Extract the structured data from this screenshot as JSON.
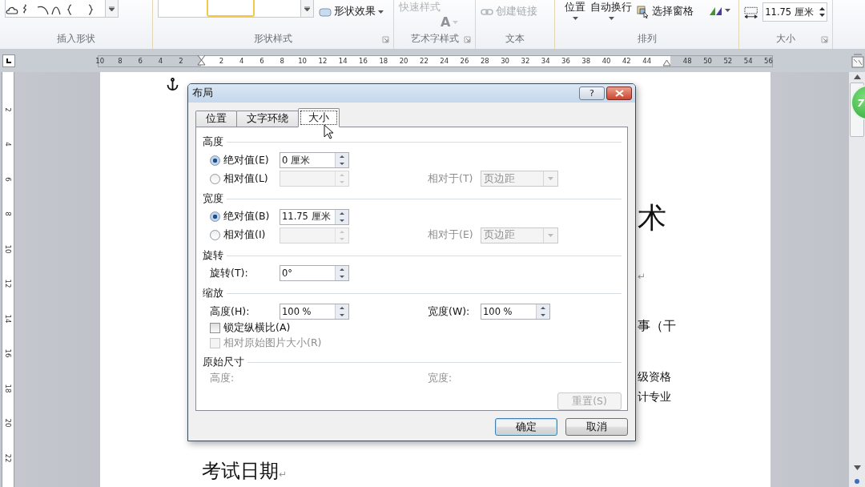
{
  "ribbon": {
    "groups": [
      {
        "kind": "shapes",
        "label": "插入形状"
      },
      {
        "kind": "styles",
        "label": "形状样式",
        "effects_button": "形状效果"
      },
      {
        "kind": "wordart",
        "label": "艺术字样式",
        "quick_styles": "快速样式",
        "text_effects": "A"
      },
      {
        "kind": "text",
        "label": "文本",
        "link_button": "创建链接"
      },
      {
        "kind": "arrange",
        "label": "排列",
        "position_button": "位置",
        "wrap_button": "自动换行",
        "pane_button": "选择窗格"
      },
      {
        "kind": "size",
        "label": "大小",
        "width_field": "11.75 厘米"
      }
    ]
  },
  "horizontal_ruler": {
    "ticks": [
      {
        "kind": "label",
        "text": "10"
      },
      {
        "kind": "label",
        "text": "8"
      },
      {
        "kind": "label",
        "text": "6"
      },
      {
        "kind": "label",
        "text": "4"
      },
      {
        "kind": "label",
        "text": "2"
      },
      {
        "kind": "indent"
      },
      {
        "kind": "label",
        "text": "2"
      },
      {
        "kind": "label",
        "text": "4"
      },
      {
        "kind": "label",
        "text": "6"
      },
      {
        "kind": "label",
        "text": "8"
      },
      {
        "kind": "label",
        "text": "10"
      },
      {
        "kind": "label",
        "text": "12"
      },
      {
        "kind": "label",
        "text": "14"
      },
      {
        "kind": "label",
        "text": "16"
      },
      {
        "kind": "label",
        "text": "18"
      },
      {
        "kind": "label",
        "text": "20"
      },
      {
        "kind": "label",
        "text": "22"
      },
      {
        "kind": "label",
        "text": "24"
      },
      {
        "kind": "label",
        "text": "26"
      },
      {
        "kind": "label",
        "text": "28"
      },
      {
        "kind": "label",
        "text": "30"
      },
      {
        "kind": "label",
        "text": "32"
      },
      {
        "kind": "label",
        "text": "34"
      },
      {
        "kind": "label",
        "text": "36"
      },
      {
        "kind": "label",
        "text": "38"
      },
      {
        "kind": "label",
        "text": "40"
      },
      {
        "kind": "label",
        "text": "42"
      },
      {
        "kind": "label",
        "text": "44"
      },
      {
        "kind": "right_indent"
      },
      {
        "kind": "label",
        "text": "48"
      },
      {
        "kind": "label",
        "text": "50"
      },
      {
        "kind": "label",
        "text": "52"
      },
      {
        "kind": "label",
        "text": "54"
      },
      {
        "kind": "label",
        "text": "56"
      }
    ]
  },
  "vertical_ruler": {
    "ticks": [
      "2",
      "4",
      "6",
      "8",
      "10",
      "12",
      "14",
      "16",
      "18",
      "20",
      "22"
    ]
  },
  "document": {
    "lines": [
      {
        "kind": "heading",
        "text": "术"
      },
      {
        "kind": "mark",
        "text": "↵"
      },
      {
        "kind": "body",
        "text": "事（干"
      },
      {
        "kind": "small",
        "text": "级资格"
      },
      {
        "kind": "small",
        "text": "计专业"
      }
    ],
    "footer": {
      "text": "考试日期",
      "para_mark": "↵"
    }
  },
  "scrollbar": {
    "badge": "7"
  },
  "dialog": {
    "title": "布局",
    "help_button": "?",
    "tabs": [
      {
        "label": "位置",
        "selected": false
      },
      {
        "label": "文字环绕",
        "selected": false
      },
      {
        "label": "大小",
        "selected": true
      }
    ],
    "sections": [
      {
        "kind": "size",
        "heading": "高度",
        "absolute": {
          "label": "绝对值(E)",
          "selected": true,
          "value": "0 厘米"
        },
        "relative": {
          "label": "相对值(L)",
          "selected": false,
          "relative_to_label": "相对于(T)",
          "relative_to_value": "页边距"
        }
      },
      {
        "kind": "size",
        "heading": "宽度",
        "absolute": {
          "label": "绝对值(B)",
          "selected": true,
          "value": "11.75 厘米"
        },
        "relative": {
          "label": "相对值(I)",
          "selected": false,
          "relative_to_label": "相对于(E)",
          "relative_to_value": "页边距"
        }
      },
      {
        "kind": "rotation",
        "heading": "旋转",
        "label": "旋转(T):",
        "value": "0°"
      },
      {
        "kind": "scale",
        "heading": "缩放",
        "height_label": "高度(H):",
        "height_value": "100 %",
        "width_label": "宽度(W):",
        "width_value": "100 %",
        "lock": {
          "label": "锁定纵横比(A)",
          "checked": false,
          "disabled": false
        },
        "relative_original": {
          "label": "相对原始图片大小(R)",
          "checked": false,
          "disabled": true
        }
      },
      {
        "kind": "original",
        "heading": "原始尺寸",
        "height_label": "高度:",
        "width_label": "宽度:",
        "reset_button": {
          "label": "重置(S)",
          "disabled": true
        }
      }
    ],
    "ok_button": "确定",
    "cancel_button": "取消"
  }
}
